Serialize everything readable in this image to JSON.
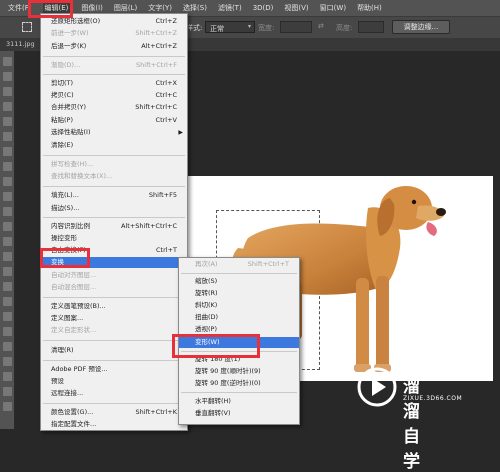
{
  "menubar": {
    "items": [
      "文件(F)",
      "编辑(E)",
      "图像(I)",
      "图层(L)",
      "文字(Y)",
      "选择(S)",
      "滤镜(T)",
      "3D(D)",
      "视图(V)",
      "窗口(W)",
      "帮助(H)"
    ]
  },
  "options_bar": {
    "style_label": "样式:",
    "style_value": "正常",
    "width_label": "宽度:",
    "height_label": "高度:",
    "adjust_edge_button": "调整边缘..."
  },
  "document": {
    "tab_label": "3111.jpg"
  },
  "edit_menu": {
    "items": [
      {
        "label": "还原矩形选框(O)",
        "shortcut": "Ctrl+Z"
      },
      {
        "label": "前进一步(W)",
        "shortcut": "Shift+Ctrl+Z"
      },
      {
        "label": "后退一步(K)",
        "shortcut": "Alt+Ctrl+Z"
      },
      {
        "label": "渐隐(D)...",
        "shortcut": "Shift+Ctrl+F"
      },
      {
        "label": "剪切(T)",
        "shortcut": "Ctrl+X"
      },
      {
        "label": "拷贝(C)",
        "shortcut": "Ctrl+C"
      },
      {
        "label": "合并拷贝(Y)",
        "shortcut": "Shift+Ctrl+C"
      },
      {
        "label": "粘贴(P)",
        "shortcut": "Ctrl+V"
      },
      {
        "label": "选择性粘贴(I)",
        "shortcut": ""
      },
      {
        "label": "清除(E)",
        "shortcut": ""
      },
      {
        "label": "拼写检查(H)...",
        "shortcut": ""
      },
      {
        "label": "查找和替换文本(X)...",
        "shortcut": ""
      },
      {
        "label": "填充(L)...",
        "shortcut": "Shift+F5"
      },
      {
        "label": "描边(S)...",
        "shortcut": ""
      },
      {
        "label": "内容识别比例",
        "shortcut": "Alt+Shift+Ctrl+C"
      },
      {
        "label": "操控变形",
        "shortcut": ""
      },
      {
        "label": "自由变换(F)",
        "shortcut": "Ctrl+T"
      },
      {
        "label": "变换",
        "shortcut": ""
      },
      {
        "label": "自动对齐图层...",
        "shortcut": ""
      },
      {
        "label": "自动混合图层...",
        "shortcut": ""
      },
      {
        "label": "定义画笔预设(B)...",
        "shortcut": ""
      },
      {
        "label": "定义图案...",
        "shortcut": ""
      },
      {
        "label": "定义自定形状...",
        "shortcut": ""
      },
      {
        "label": "清理(R)",
        "shortcut": ""
      },
      {
        "label": "Adobe PDF 预设...",
        "shortcut": ""
      },
      {
        "label": "预设",
        "shortcut": ""
      },
      {
        "label": "远程连接...",
        "shortcut": ""
      },
      {
        "label": "颜色设置(G)...",
        "shortcut": "Shift+Ctrl+K"
      },
      {
        "label": "指定配置文件...",
        "shortcut": ""
      }
    ]
  },
  "transform_menu": {
    "items": [
      {
        "label": "再次(A)",
        "shortcut": "Shift+Ctrl+T"
      },
      {
        "label": "缩放(S)",
        "shortcut": ""
      },
      {
        "label": "旋转(R)",
        "shortcut": ""
      },
      {
        "label": "斜切(K)",
        "shortcut": ""
      },
      {
        "label": "扭曲(D)",
        "shortcut": ""
      },
      {
        "label": "透视(P)",
        "shortcut": ""
      },
      {
        "label": "变形(W)",
        "shortcut": ""
      },
      {
        "label": "旋转 180 度(1)",
        "shortcut": ""
      },
      {
        "label": "旋转 90 度(顺时针)(9)",
        "shortcut": ""
      },
      {
        "label": "旋转 90 度(逆时针)(0)",
        "shortcut": ""
      },
      {
        "label": "水平翻转(H)",
        "shortcut": ""
      },
      {
        "label": "垂直翻转(V)",
        "shortcut": ""
      }
    ]
  },
  "watermark": {
    "brand": "溜溜自学",
    "site": "ZIXUE.3D66.COM"
  },
  "colors": {
    "highlight": "#3c78dd",
    "annotation_red": "#e8303a"
  }
}
